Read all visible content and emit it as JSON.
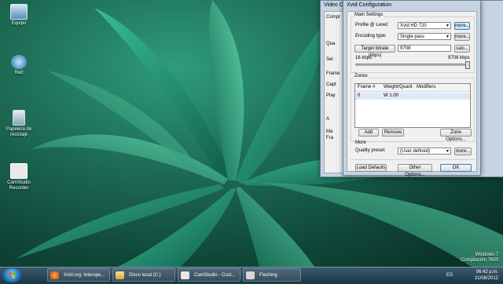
{
  "desktop": {
    "icons": [
      {
        "label": "Equipo",
        "icon": "computer-icon"
      },
      {
        "label": "Red",
        "icon": "network-icon"
      },
      {
        "label": "Papelera de reciclaje",
        "icon": "recycle-bin-icon"
      },
      {
        "label": "CamStudio Recorder",
        "icon": "camstudio-icon"
      }
    ],
    "watermark": {
      "line1": "Windows 7",
      "line2": "Compilación 7600"
    }
  },
  "video_window": {
    "title": "Video Op",
    "labels": [
      "Compr",
      "Qua",
      "Sel",
      "Frame",
      "Capt",
      "Play",
      "A",
      "Ma",
      "Fra"
    ]
  },
  "xvid": {
    "title": "Xvid Configuration",
    "main_settings": {
      "title": "Main Settings",
      "profile_label": "Profile @ Level:",
      "profile_value": "Xvid HD 720",
      "encoding_label": "Encoding type:",
      "encoding_value": "Single pass",
      "target_button": "Target bitrate (kbps)",
      "target_value": "9708",
      "calc_button": "calc...",
      "more_button": "more...",
      "slider_min": "16 kbps",
      "slider_max": "9708 kbps",
      "slider_fraction": 1.0
    },
    "zones": {
      "title": "Zones",
      "columns": [
        "Frame #",
        "Weight/Quant",
        "Modifiers"
      ],
      "rows": [
        [
          "0",
          "W 1.00",
          ""
        ]
      ],
      "add_button": "Add",
      "remove_button": "Remove",
      "zone_options_button": "Zone Options..."
    },
    "more": {
      "title": "More",
      "quality_label": "Quality preset:",
      "quality_value": "(User defined)",
      "more_button": "more..."
    },
    "buttons": {
      "load_defaults": "Load Defaults",
      "other_options": "Other Options...",
      "ok": "OK"
    }
  },
  "taskbar": {
    "buttons": [
      {
        "label": "Xvid.org: Interope...",
        "icon": "firefox-icon"
      },
      {
        "label": "Disco local (C:)",
        "icon": "folder-icon"
      },
      {
        "label": "CamStudio - Cust...",
        "icon": "camstudio-icon"
      },
      {
        "label": "Flashing",
        "icon": "flash-icon"
      }
    ],
    "tray_lang": "ES",
    "time": "06:42 p.m.",
    "date": "21/08/2012"
  },
  "colors": {
    "accent": "#3c7fb1",
    "window_frame": "#c5d3e2",
    "taskbar": "#1c3545"
  }
}
